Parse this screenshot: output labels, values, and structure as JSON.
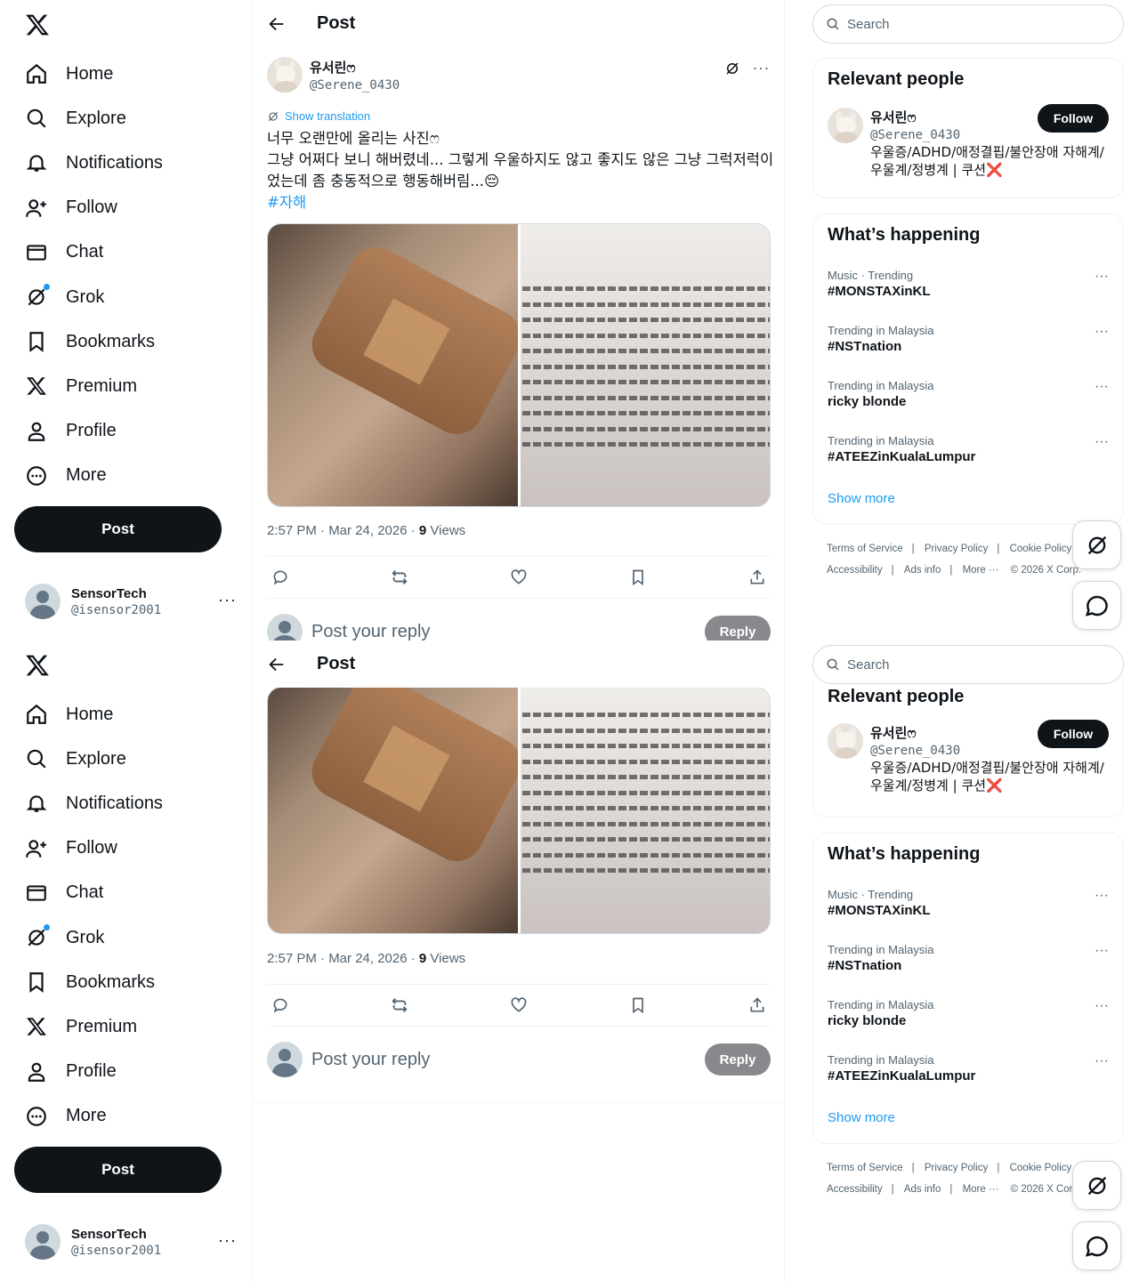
{
  "nav": {
    "items": [
      {
        "label": "Home",
        "icon": "home-icon"
      },
      {
        "label": "Explore",
        "icon": "search-icon"
      },
      {
        "label": "Notifications",
        "icon": "bell-icon"
      },
      {
        "label": "Follow",
        "icon": "person-add-icon"
      },
      {
        "label": "Chat",
        "icon": "envelope-icon"
      },
      {
        "label": "Grok",
        "icon": "grok-icon"
      },
      {
        "label": "Bookmarks",
        "icon": "bookmark-icon"
      },
      {
        "label": "Premium",
        "icon": "x-logo-icon"
      },
      {
        "label": "Profile",
        "icon": "person-icon"
      },
      {
        "label": "More",
        "icon": "more-circle-icon"
      }
    ],
    "post_label": "Post"
  },
  "account": {
    "name": "SensorTech",
    "handle": "@isensor2001"
  },
  "header": {
    "title": "Post"
  },
  "post": {
    "author_name": "유서린ෆ",
    "author_handle": "@Serene_0430",
    "show_translation": "Show translation",
    "text_line1": "너무 오랜만에 올리는 사진ෆ",
    "text_line2": "그냥 어쩌다 보니 해버렸네... 그렇게 우울하지도 않고 좋지도 않은 그냥 그럭저럭이었는데 좀 충동적으로 행동해버림...😔",
    "hashtag": "#자해",
    "timestamp": "2:57 PM · Mar 24, 2026 · ",
    "views_count": "9",
    "views_label": " Views",
    "reply_placeholder": "Post your reply",
    "reply_button": "Reply"
  },
  "right": {
    "search_placeholder": "Search",
    "relevant_title": "Relevant people",
    "person": {
      "name": "유서린ෆ",
      "handle": "@Serene_0430",
      "bio": "우울증/ADHD/애정결핍/불안장애 자해계/우울계/정병계 | 쿠션❌",
      "follow_label": "Follow"
    },
    "happening_title": "What’s happening",
    "trends": [
      {
        "category": "Music · Trending",
        "name": "#MONSTAXinKL"
      },
      {
        "category": "Trending in Malaysia",
        "name": "#NSTnation"
      },
      {
        "category": "Trending in Malaysia",
        "name": "ricky blonde"
      },
      {
        "category": "Trending in Malaysia",
        "name": "#ATEEZinKualaLumpur"
      }
    ],
    "show_more": "Show more",
    "footer": {
      "terms": "Terms of Service",
      "privacy": "Privacy Policy",
      "cookie": "Cookie Policy",
      "accessibility": "Accessibility",
      "ads": "Ads info",
      "more": "More ···",
      "copyright": "© 2026 X Corp."
    }
  }
}
